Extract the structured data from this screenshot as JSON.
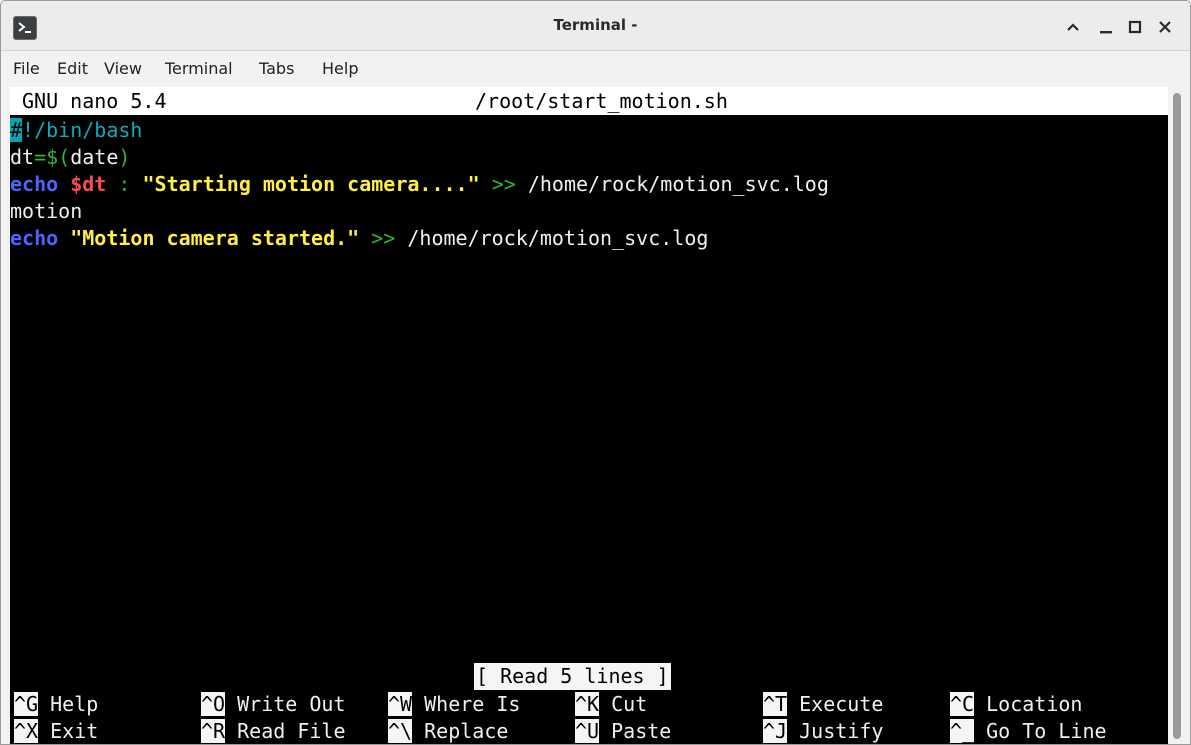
{
  "window": {
    "title": "Terminal -",
    "icons": {
      "app": "terminal-app-icon",
      "minimize_up": "chevron-up-icon",
      "minimize": "minimize-icon",
      "maximize": "maximize-icon",
      "close": "close-icon"
    }
  },
  "menu": [
    "File",
    "Edit",
    "View",
    "Terminal",
    "Tabs",
    "Help"
  ],
  "nano": {
    "version": "GNU nano 5.4",
    "filename": "/root/start_motion.sh",
    "status": "[ Read 5 lines ]"
  },
  "code": {
    "line1": {
      "hash": "#",
      "rest": "!/bin/bash"
    },
    "line2": {
      "a": "dt",
      "b": "=$(",
      "c": "date",
      "d": ")"
    },
    "line3": {
      "kw": "echo",
      "var": "$dt",
      "colon": ":",
      "str": "\"Starting motion camera....\"",
      "redir": ">>",
      "path": "/home/rock/motion_svc.log"
    },
    "line4": {
      "text": "motion"
    },
    "line5": {
      "kw": "echo",
      "str": "\"Motion camera started.\"",
      "redir": ">>",
      "path": "/home/rock/motion_svc.log"
    }
  },
  "shortcuts": [
    {
      "key": "^G",
      "label": "Help"
    },
    {
      "key": "^O",
      "label": "Write Out"
    },
    {
      "key": "^W",
      "label": "Where Is"
    },
    {
      "key": "^K",
      "label": "Cut"
    },
    {
      "key": "^T",
      "label": "Execute"
    },
    {
      "key": "^C",
      "label": "Location"
    },
    {
      "key": "^X",
      "label": "Exit"
    },
    {
      "key": "^R",
      "label": "Read File"
    },
    {
      "key": "^\\",
      "label": "Replace"
    },
    {
      "key": "^U",
      "label": "Paste"
    },
    {
      "key": "^J",
      "label": "Justify"
    },
    {
      "key": "^_",
      "label": "Go To Line"
    }
  ],
  "colors": {
    "keyword": "#4d63ff",
    "variable": "#ff4a4a",
    "string": "#ffee44",
    "operator": "#2fb52f",
    "shebang": "#12a8b8"
  }
}
